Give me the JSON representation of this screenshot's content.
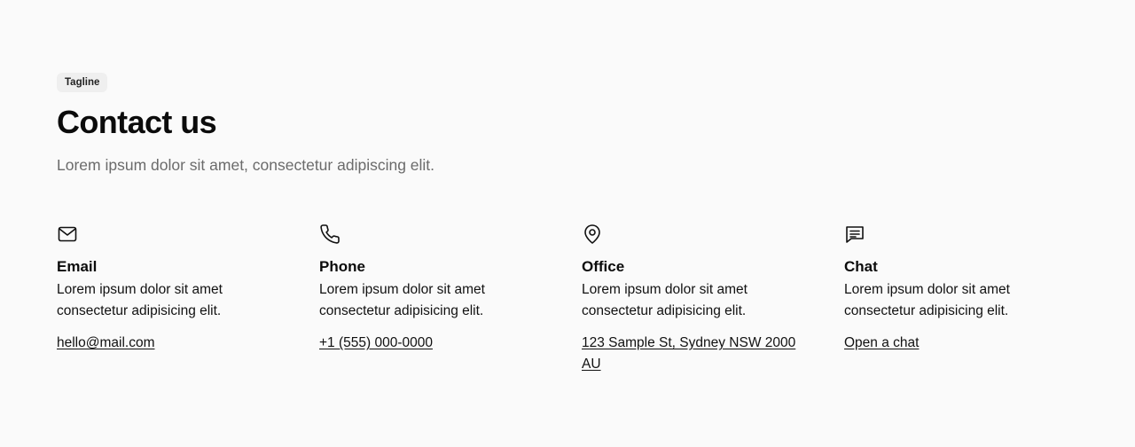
{
  "header": {
    "tagline": "Tagline",
    "title": "Contact us",
    "subtitle": "Lorem ipsum dolor sit amet, consectetur adipiscing elit."
  },
  "contacts": [
    {
      "icon": "mail-icon",
      "title": "Email",
      "description": "Lorem ipsum dolor sit amet consectetur adipisicing elit.",
      "link": "hello@mail.com"
    },
    {
      "icon": "phone-icon",
      "title": "Phone",
      "description": "Lorem ipsum dolor sit amet consectetur adipisicing elit.",
      "link": "+1 (555) 000-0000"
    },
    {
      "icon": "map-pin-icon",
      "title": "Office",
      "description": "Lorem ipsum dolor sit amet consectetur adipisicing elit.",
      "link": "123 Sample St, Sydney NSW 2000 AU"
    },
    {
      "icon": "chat-icon",
      "title": "Chat",
      "description": "Lorem ipsum dolor sit amet consectetur adipisicing elit.",
      "link": "Open a chat"
    }
  ],
  "colors": {
    "background": "#fafafa",
    "text": "#111111",
    "muted": "#6b6b6b",
    "tagline_bg": "#efefef"
  }
}
